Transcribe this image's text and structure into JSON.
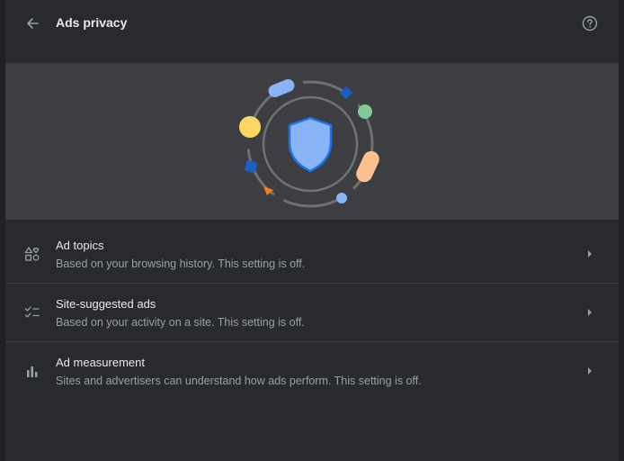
{
  "header": {
    "title": "Ads privacy",
    "back_icon": "arrow-left-icon",
    "help_icon": "help-circle-icon"
  },
  "hero": {
    "illustration": "shield-with-orbiting-shapes",
    "colors": {
      "shield_fill": "#8ab4f8",
      "shield_stroke": "#1a73e8",
      "yellow": "#fdd663",
      "green": "#81c995",
      "peach": "#fcc18f",
      "blue_light": "#8ab4f8",
      "blue_dark": "#1a5fc4",
      "orange": "#fa7b17"
    }
  },
  "settings": {
    "items": [
      {
        "title": "Ad topics",
        "subtitle": "Based on your browsing history. This setting is off.",
        "icon": "shapes-icon"
      },
      {
        "title": "Site-suggested ads",
        "subtitle": "Based on your activity on a site. This setting is off.",
        "icon": "checklist-icon"
      },
      {
        "title": "Ad measurement",
        "subtitle": "Sites and advertisers can understand how ads perform. This setting is off.",
        "icon": "bar-chart-icon"
      }
    ],
    "arrow_icon": "chevron-right-icon"
  },
  "colors": {
    "background": "#202124",
    "panel": "#292a2d",
    "hero_background": "#3c3e41",
    "primary_text": "#e8eaed",
    "secondary_text": "#9aa0a6",
    "divider": "#3c4043"
  }
}
